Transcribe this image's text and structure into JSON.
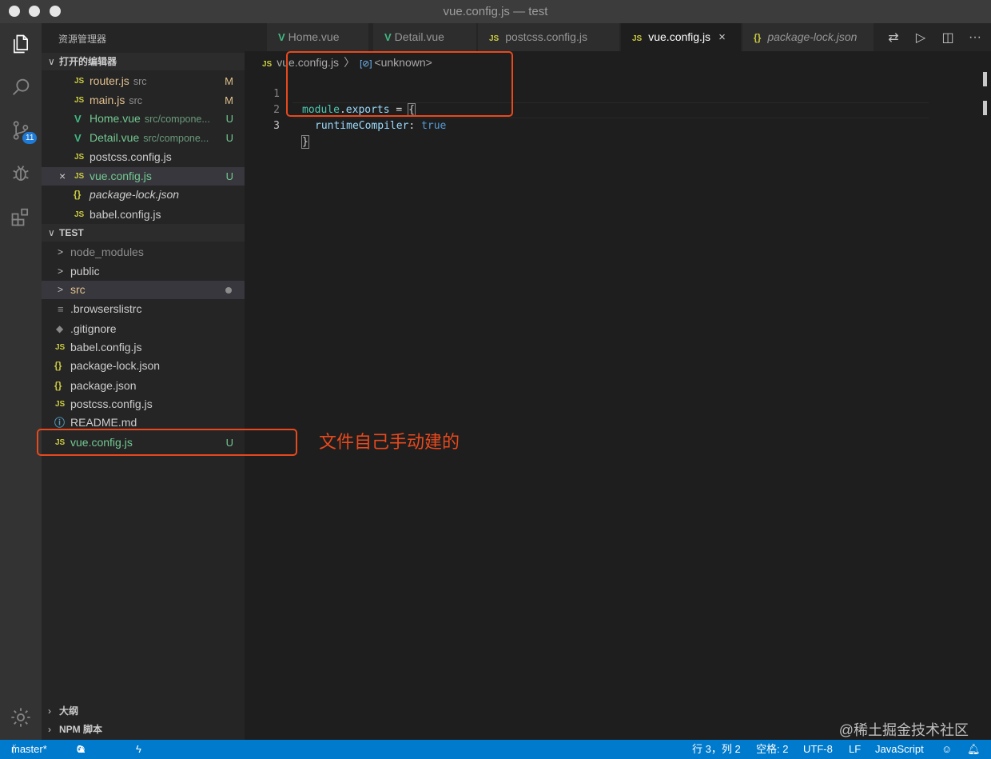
{
  "window": {
    "title": "vue.config.js — test"
  },
  "sidebar": {
    "title": "资源管理器",
    "open_editors": {
      "header": "打开的编辑器",
      "items": [
        {
          "icon": "JS",
          "name": "router.js",
          "path": "src",
          "status": "M"
        },
        {
          "icon": "JS",
          "name": "main.js",
          "path": "src",
          "status": "M"
        },
        {
          "icon": "V",
          "name": "Home.vue",
          "path": "src/compone...",
          "status": "U"
        },
        {
          "icon": "V",
          "name": "Detail.vue",
          "path": "src/compone...",
          "status": "U"
        },
        {
          "icon": "JS",
          "name": "postcss.config.js",
          "path": "",
          "status": ""
        },
        {
          "icon": "JS",
          "name": "vue.config.js",
          "path": "",
          "status": "U",
          "close": "×"
        },
        {
          "icon": "{}",
          "name": "package-lock.json",
          "path": "",
          "status": ""
        },
        {
          "icon": "JS",
          "name": "babel.config.js",
          "path": "",
          "status": ""
        }
      ]
    },
    "project": {
      "header": "TEST",
      "items": [
        {
          "icon": ">",
          "name": "node_modules"
        },
        {
          "icon": ">",
          "name": "public"
        },
        {
          "icon": ">",
          "name": "src"
        },
        {
          "icon": "≡",
          "name": ".browserslistrc"
        },
        {
          "icon": "◆",
          "name": ".gitignore"
        },
        {
          "icon": "JS",
          "name": "babel.config.js"
        },
        {
          "icon": "{}",
          "name": "package-lock.json"
        },
        {
          "icon": "{}",
          "name": "package.json"
        },
        {
          "icon": "JS",
          "name": "postcss.config.js"
        },
        {
          "icon": "ⓘ",
          "name": "README.md"
        },
        {
          "icon": "JS",
          "name": "vue.config.js",
          "status": "U"
        }
      ]
    },
    "outline": "大纲",
    "npm": "NPM 脚本"
  },
  "activity": {
    "scm_badge": "11"
  },
  "tabs": [
    {
      "icon": "V",
      "label": "Home.vue"
    },
    {
      "icon": "V",
      "label": "Detail.vue"
    },
    {
      "icon": "JS",
      "label": "postcss.config.js"
    },
    {
      "icon": "JS",
      "label": "vue.config.js",
      "close": "×"
    },
    {
      "icon": "{}",
      "label": "package-lock.json"
    }
  ],
  "breadcrumb": {
    "icon": "JS",
    "file": "vue.config.js",
    "sep": "〉",
    "symbol_icon": "[⊘]",
    "symbol": "<unknown>"
  },
  "code": {
    "line_numbers": [
      "1",
      "2",
      "3"
    ],
    "l1": {
      "module": "module",
      "dot": ".",
      "exports": "exports",
      "eq": " = ",
      "brace": "{"
    },
    "l2": {
      "key": "runtimeCompiler",
      "colon": ": ",
      "value": "true"
    },
    "l3": {
      "brace": "}"
    }
  },
  "annotation": {
    "text": "文件自己手动建的"
  },
  "status_bar": {
    "branch": "master*",
    "errors": "0",
    "warnings": "0",
    "position": "行 3，列 2",
    "indent": "空格: 2",
    "encoding": "UTF-8",
    "eol": "LF",
    "language": "JavaScript"
  },
  "watermark": "@稀土掘金技术社区"
}
